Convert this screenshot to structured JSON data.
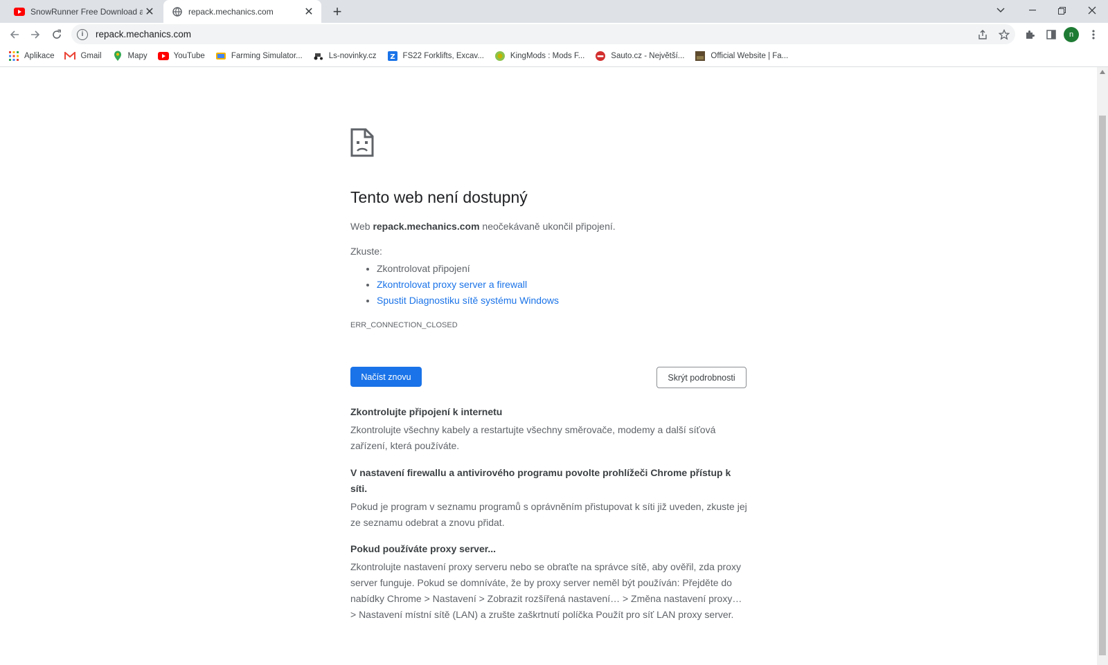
{
  "browser": {
    "tabs": [
      {
        "title": "SnowRunner Free Download and",
        "active": false,
        "icon": "youtube-icon"
      },
      {
        "title": "repack.mechanics.com",
        "active": true,
        "icon": "globe-icon"
      }
    ],
    "url": "repack.mechanics.com",
    "profile_initial": "n"
  },
  "bookmarks": [
    {
      "label": "Aplikace",
      "icon": "apps-grid-icon"
    },
    {
      "label": "Gmail",
      "icon": "gmail-icon"
    },
    {
      "label": "Mapy",
      "icon": "maps-pin-icon"
    },
    {
      "label": "YouTube",
      "icon": "youtube-icon"
    },
    {
      "label": "Farming Simulator...",
      "icon": "farming-simulator-icon"
    },
    {
      "label": "Ls-novinky.cz",
      "icon": "tractor-icon"
    },
    {
      "label": "FS22 Forklifts, Excav...",
      "icon": "fs22-icon"
    },
    {
      "label": "KingMods : Mods F...",
      "icon": "kingmods-icon"
    },
    {
      "label": "Sauto.cz - Největší...",
      "icon": "sauto-icon"
    },
    {
      "label": "Official Website | Fa...",
      "icon": "website-icon"
    }
  ],
  "error": {
    "heading": "Tento web není dostupný",
    "msg_prefix": "Web",
    "host": "repack.mechanics.com",
    "msg_suffix": "neočekávaně ukončil připojení.",
    "try_label": "Zkuste:",
    "suggestions": [
      "Zkontrolovat připojení",
      "Zkontrolovat proxy server a firewall",
      "Spustit Diagnostiku sítě systému Windows"
    ],
    "code": "ERR_CONNECTION_CLOSED",
    "reload_label": "Načíst znovu",
    "details_label": "Skrýt podrobnosti"
  },
  "details": [
    {
      "heading": "Zkontrolujte připojení k internetu",
      "text": "Zkontrolujte všechny kabely a restartujte všechny směrovače, modemy a další síťová zařízení, která používáte."
    },
    {
      "heading": "V nastavení firewallu a antivirového programu povolte prohlížeči Chrome přístup k síti.",
      "text": "Pokud je program v seznamu programů s oprávněním přistupovat k síti již uveden, zkuste jej ze seznamu odebrat a znovu přidat."
    },
    {
      "heading": "Pokud používáte proxy server...",
      "text": "Zkontrolujte nastavení proxy serveru nebo se obraťte na správce sítě, aby ověřil, zda proxy server funguje. Pokud se domníváte, že by proxy server neměl být používán: Přejděte do nabídky Chrome > Nastavení > Zobrazit rozšířená nastavení… > Změna nastavení proxy… > Nastavení místní sítě (LAN) a zrušte zaškrtnutí políčka Použít pro síť LAN proxy server."
    }
  ]
}
